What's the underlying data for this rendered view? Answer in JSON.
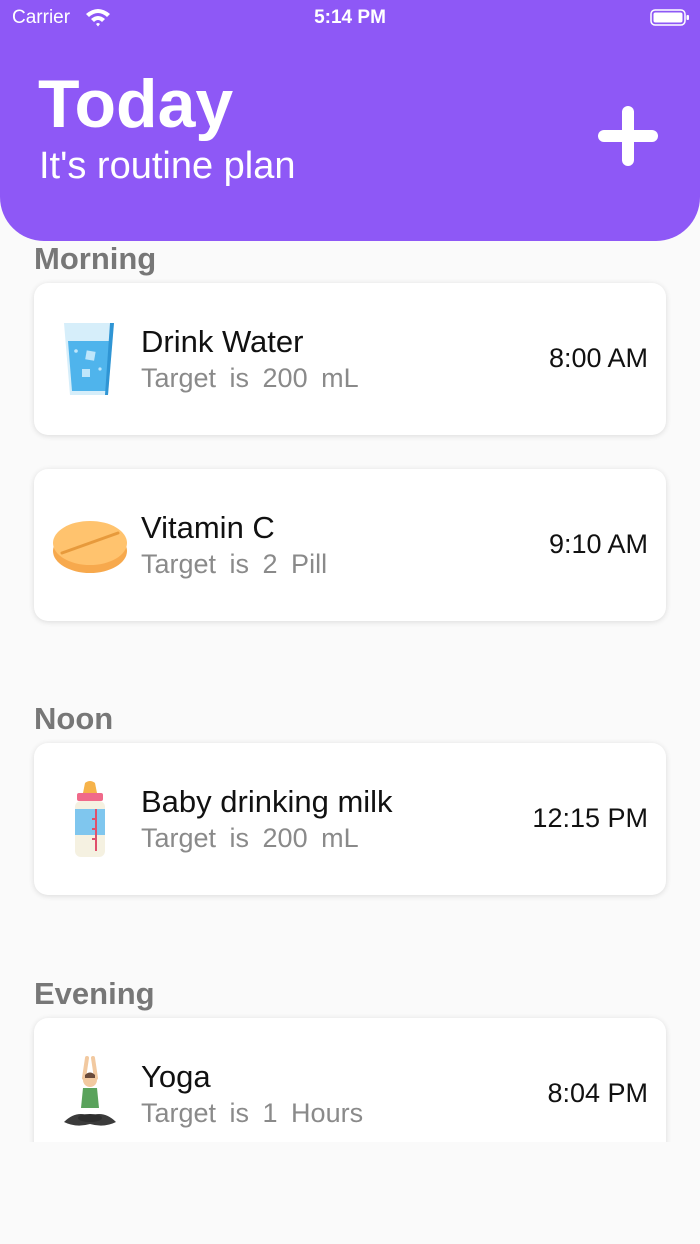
{
  "status_bar": {
    "carrier": "Carrier",
    "time": "5:14 PM"
  },
  "header": {
    "title": "Today",
    "subtitle": "It's routine plan",
    "add_icon": "plus-icon"
  },
  "sections": [
    {
      "title": "Morning"
    },
    {
      "title": "Noon"
    },
    {
      "title": "Evening"
    }
  ],
  "tasks": [
    {
      "name": "Drink Water",
      "target": "Target is 200 mL",
      "time": "8:00 AM",
      "icon": "water-glass-icon"
    },
    {
      "name": "Vitamin C",
      "target": "Target is 2 Pill",
      "time": "9:10 AM",
      "icon": "pill-icon"
    },
    {
      "name": "Baby drinking milk",
      "target": "Target is 200 mL",
      "time": "12:15 PM",
      "icon": "baby-bottle-icon"
    },
    {
      "name": "Yoga",
      "target": "Target is 1 Hours",
      "time": "8:04 PM",
      "icon": "yoga-icon"
    }
  ],
  "colors": {
    "accent": "#8e58f6",
    "section_text": "#777777",
    "secondary_text": "#8a8a8a"
  }
}
